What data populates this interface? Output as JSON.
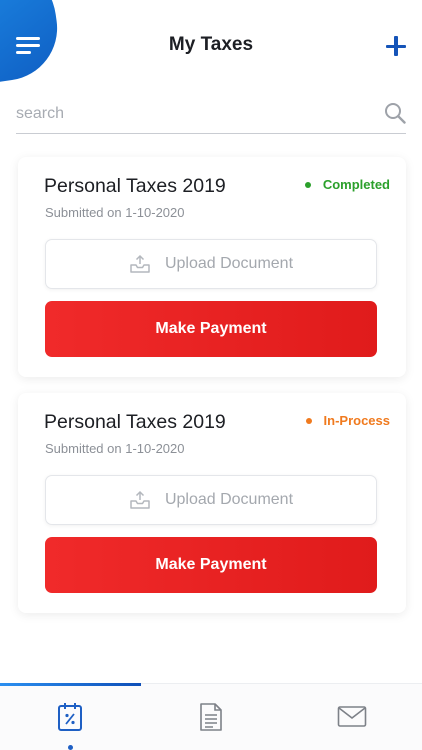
{
  "header": {
    "title": "My Taxes",
    "menu_icon": "hamburger-menu-icon",
    "add_icon": "plus-icon",
    "accent_color": "#1554b8"
  },
  "search": {
    "placeholder": "search",
    "value": "",
    "icon": "search-icon"
  },
  "cards": [
    {
      "title": "Personal Taxes 2019",
      "subtitle": "Submitted on 1-10-2020",
      "status": "Completed",
      "status_color": "#2ba02b",
      "upload_label": "Upload Document",
      "pay_label": "Make Payment"
    },
    {
      "title": "Personal Taxes 2019",
      "subtitle": "Submitted on 1-10-2020",
      "status": "In-Process",
      "status_color": "#f07a1e",
      "upload_label": "Upload Document",
      "pay_label": "Make Payment"
    }
  ],
  "tabbar": {
    "tabs": [
      {
        "icon": "tax-calendar-icon",
        "active": true
      },
      {
        "icon": "document-icon",
        "active": false
      },
      {
        "icon": "mail-icon",
        "active": false
      }
    ],
    "active_color": "#1e5fc4"
  }
}
